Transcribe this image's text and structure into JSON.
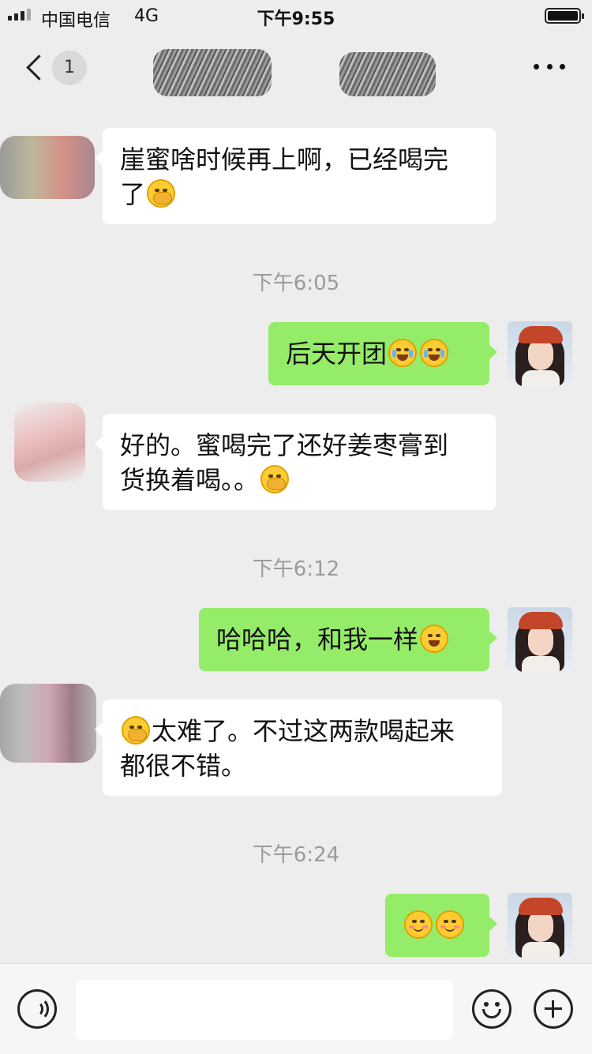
{
  "status_bar": {
    "carrier": "中国电信",
    "network": "4G",
    "time": "下午9:55"
  },
  "nav": {
    "unread_count": "1"
  },
  "messages": [
    {
      "side": "left",
      "parts": [
        "崖蜜啥时候再上啊，已经喝完",
        "了"
      ],
      "emoji_after": "facepalm"
    },
    {
      "type": "time",
      "text": "下午6:05"
    },
    {
      "side": "right",
      "text": "后天开团",
      "emojis": [
        "laugh-cry",
        "laugh-cry"
      ]
    },
    {
      "side": "left",
      "parts": [
        "好的。蜜喝完了还好姜枣膏到",
        "货换着喝。。"
      ],
      "emoji_after": "facepalm"
    },
    {
      "type": "time",
      "text": "下午6:12"
    },
    {
      "side": "right",
      "text": "哈哈哈，和我一样",
      "emojis": [
        "grin"
      ]
    },
    {
      "side": "left",
      "parts": [
        "太难了。不过这两款喝起来",
        "都很不错。"
      ],
      "emoji_before": "facepalm"
    },
    {
      "type": "time",
      "text": "下午6:24"
    },
    {
      "side": "right",
      "text": "",
      "emojis": [
        "smile",
        "smile"
      ]
    }
  ]
}
